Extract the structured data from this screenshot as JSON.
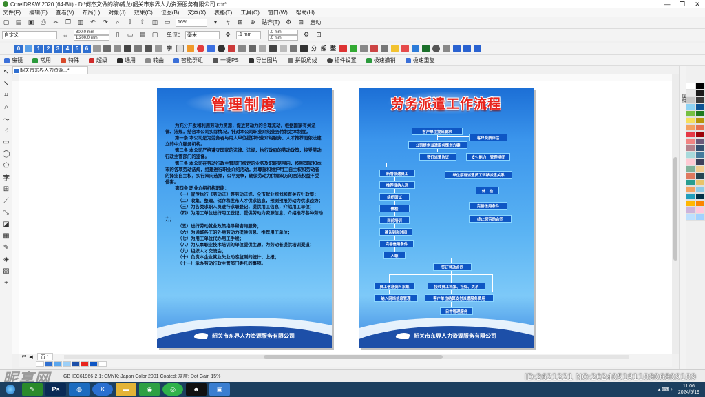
{
  "window": {
    "title": "CorelDRAW 2020 (64-Bit) - D:\\何杰文做的稿\\威龙\\韶关市东界人力资源服务有限公司.cdr*",
    "controls": [
      "—",
      "❐",
      "✕"
    ]
  },
  "menu": [
    "文件(F)",
    "编辑(E)",
    "查看(V)",
    "布局(L)",
    "对象(J)",
    "效果(C)",
    "位图(B)",
    "文本(X)",
    "表格(T)",
    "工具(O)",
    "窗口(W)",
    "帮助(H)"
  ],
  "toolbar1": {
    "zoom": "16%",
    "paste_label": "贴齐(T)",
    "launch_label": "启动"
  },
  "toolbar2": {
    "paper": "自定义",
    "width": "800.0 mm",
    "height": "1,200.0 mm",
    "units_label": "单位：",
    "units": "毫米",
    "nudge": ".1 mm",
    "dup_x": ".0 mm",
    "dup_y": ".0 mm"
  },
  "toolbar3": {
    "numbers": [
      "0",
      "1",
      "2",
      "3",
      "4",
      "5",
      "6"
    ],
    "labels": [
      "字",
      "分",
      "拆",
      "整",
      "转"
    ]
  },
  "plugins": [
    "魔镜",
    "常用",
    "特殊",
    "超级",
    "通用",
    "转曲",
    "智能群组",
    "一键PS",
    "导出图片",
    "拼版角线",
    "插件设置",
    "极速撤销",
    "极速重复"
  ],
  "document_tab": "韶关市东界人力资源...*",
  "page_tab": "页 1",
  "status_text": "GB IEC61966-2.1; CMYK: Japan Color 2001 Coated; 灰度: Dot Gain 15%",
  "right_dock_label": "属性",
  "watermark": {
    "site": "昵享网",
    "id": "ID:2621221 NO:20240519110806809109"
  },
  "taskbar": {
    "time": "11:06",
    "date": "2024/5/19"
  },
  "poster_left": {
    "title": "管理制度",
    "paragraphs": [
      "为充分开发和利用劳动力资源，促进劳动力的合理流动，根据国家有关法律、法规，结合本公司实际情况，针对本公司职业介绍业务特制定本制度。",
      "第一条 本公司是为劳务者与用人单位提供职业介绍服务、人才推荐而依法建立的中介服务机构。",
      "第二条 本公司严格遵守国家的法律、法规，执行政府的劳动政策，接受劳动行政主管部门的监督。",
      "第三条 本公司在劳动行政主管部门核定的业务及职能范围内，按照国家和本市的各项劳动法规，组建进行职业介绍活动，并尊重和维护用工自主权和劳动者的择业自主权，实行双向选择，公平竞争，确保劳动力供需双方的合法权益不受侵害。",
      "第四条 职业介绍机构职能："
    ],
    "items": [
      "（一）宣传执行《劳动法》等劳动法规，全市就业规划和有关方针政策；",
      "（二）收集、整理、储存和发布人才供求信息，预测预报劳动力供求趋势；",
      "（三）为各类求职人员进行求职登记，提供用工信息，介绍用工单位；",
      "（四）为用工单位进行用工登记，提供劳动力资源信息，介绍推荐各种劳动力；",
      "（五）进行劳动就业政策指导和咨询服务；",
      "（六）为通城各工的外地劳动力提供信息、推荐用工单位；",
      "（七）为用工单位代办用工手续；",
      "（八）为从事职业技术培训的单位提供生源，为劳动者提供培训渠道；",
      "（九）组织人才交流会；",
      "（十）负责本企业就业失业动态监测的统计、上报；",
      "（十一）承办劳动行政主管部门委托的事项。"
    ],
    "company": "韶关市东界人力资源服务有限公司"
  },
  "poster_right": {
    "title": "劳务派遣工作流程",
    "steps": {
      "s1": "客户单位提出要求",
      "s2": "客户资质评估",
      "s3": "公司提供派遣服务策划方案",
      "s4": "签订派遣协议",
      "s5": "支付能力　管理特征",
      "s6": "新增派遣员工",
      "s7": "单位原有派遣员工转移派遣关系",
      "s8": "推荐择纳人选",
      "s9": "组织面试",
      "s10": "体检",
      "s11": "体　检",
      "s12": "岗前培训",
      "s13": "完善信用条件",
      "s14": "确认到岗时间",
      "s15": "终止原劳动合同",
      "s16": "完善信用条件",
      "s17": "入职",
      "s18": "签订劳动合同",
      "s19": "员工信息资料采集",
      "s20": "接转员工档案、社保、关系",
      "s21": "纳入网络信息管理",
      "s22": "客户单位结算支付派遣服务费用",
      "s23": "日常管理服务"
    },
    "company": "韶关市东界人力资源服务有限公司"
  },
  "colors": {
    "poster_blue": "#1c6fd6",
    "title_red": "#e8241c",
    "flow_box": "#0e56c4",
    "taskbar": "#1c3f5f"
  }
}
